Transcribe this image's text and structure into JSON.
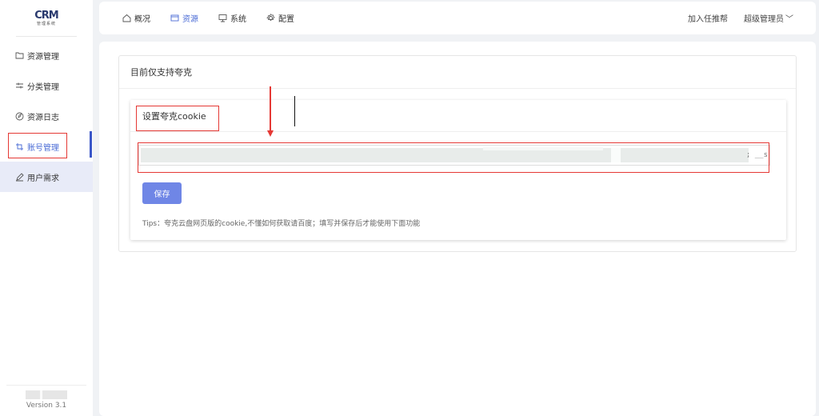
{
  "logo": {
    "mark": "CRM",
    "subtitle": "管理系统"
  },
  "sidebar": {
    "items": [
      {
        "label": "资源管理",
        "icon": "folder-icon"
      },
      {
        "label": "分类管理",
        "icon": "sliders-icon"
      },
      {
        "label": "资源日志",
        "icon": "compass-icon"
      },
      {
        "label": "账号管理",
        "icon": "crop-icon"
      },
      {
        "label": "用户需求",
        "icon": "pen-icon"
      }
    ],
    "version": "Version 3.1"
  },
  "topnav": {
    "tabs": [
      {
        "label": "概况",
        "icon": "home-icon"
      },
      {
        "label": "资源",
        "icon": "box-icon"
      },
      {
        "label": "系统",
        "icon": "monitor-icon"
      },
      {
        "label": "配置",
        "icon": "settings-icon"
      }
    ],
    "active_tab": "资源",
    "recommend": "加入任推帮",
    "user": "超级管理员"
  },
  "panel": {
    "title": "目前仅支持夸克"
  },
  "card": {
    "title": "设置夸克cookie",
    "cookie_tail": "; __s",
    "save_label": "保存",
    "tips": "Tips：夸克云盘网页版的cookie,不懂如何获取请百度；填写并保存后才能使用下面功能"
  },
  "colors": {
    "accent": "#4b6cd6",
    "button": "#6f86e6",
    "annotation": "#e53935"
  }
}
